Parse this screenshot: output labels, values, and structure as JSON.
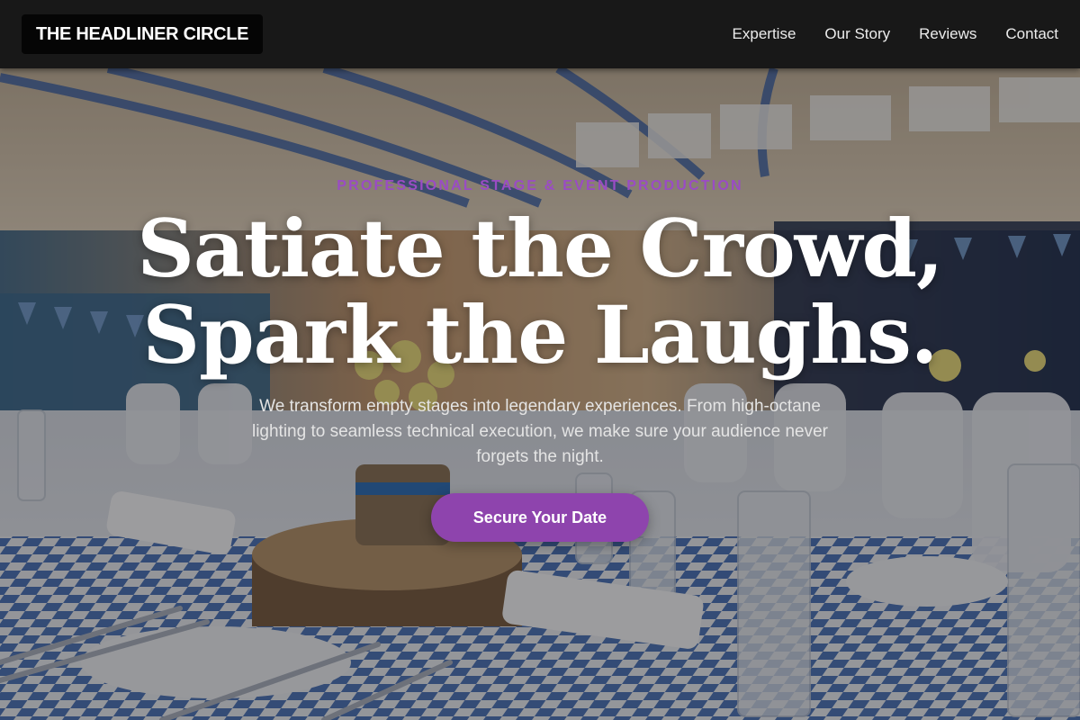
{
  "nav": {
    "brand": "THE HEADLINER CIRCLE",
    "links": [
      {
        "label": "Expertise"
      },
      {
        "label": "Our Story"
      },
      {
        "label": "Reviews"
      },
      {
        "label": "Contact"
      }
    ]
  },
  "hero": {
    "eyebrow": "PROFESSIONAL STAGE & EVENT PRODUCTION",
    "headline_line1": "Satiate the Crowd,",
    "headline_line2": "Spark the Laughs.",
    "description": "We transform empty stages into legendary experiences. From high-octane lighting to seamless technical execution, we make sure your audience never forgets the night.",
    "cta_label": "Secure Your Date",
    "background_image": "event-hall-banquet-tables-photo"
  },
  "colors": {
    "accent": "#8e44ad",
    "eyebrow": "#9a4cc4",
    "nav_bg": "#181818",
    "text": "#ffffff"
  }
}
